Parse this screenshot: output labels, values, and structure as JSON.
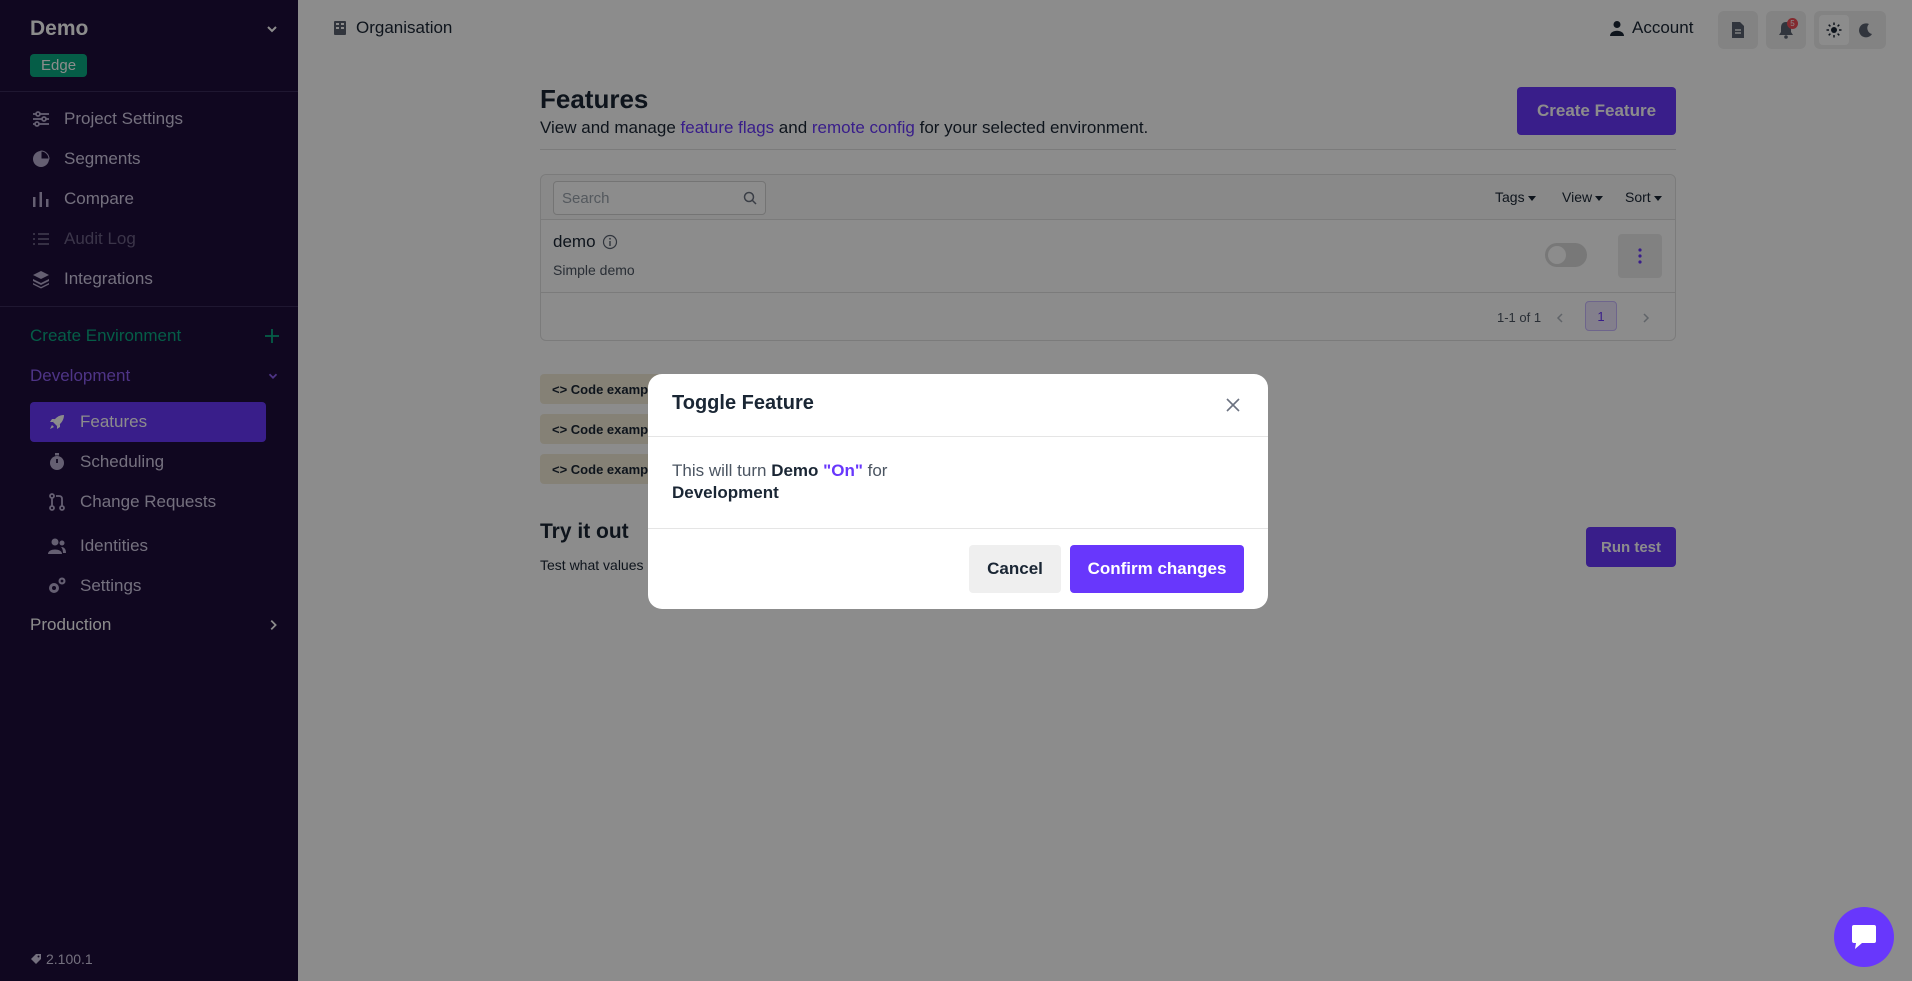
{
  "sidebar": {
    "project_name": "Demo",
    "badge": "Edge",
    "nav": [
      {
        "label": "Project Settings",
        "icon": "sliders-icon"
      },
      {
        "label": "Segments",
        "icon": "pie-chart-icon"
      },
      {
        "label": "Compare",
        "icon": "bar-chart-icon"
      },
      {
        "label": "Audit Log",
        "icon": "list-icon"
      },
      {
        "label": "Integrations",
        "icon": "layers-icon"
      }
    ],
    "create_environment": "Create Environment",
    "environments": [
      {
        "name": "Development",
        "expanded": true
      },
      {
        "name": "Production",
        "expanded": false
      }
    ],
    "env_items": [
      {
        "label": "Features",
        "icon": "rocket-icon",
        "active": true
      },
      {
        "label": "Scheduling",
        "icon": "timer-icon"
      },
      {
        "label": "Change Requests",
        "icon": "git-pull-icon"
      },
      {
        "label": "Identities",
        "icon": "people-icon"
      },
      {
        "label": "Settings",
        "icon": "gears-icon"
      }
    ],
    "version": "2.100.1"
  },
  "topbar": {
    "organisation": "Organisation",
    "account": "Account",
    "notification_count": "5"
  },
  "main": {
    "title": "Features",
    "desc_prefix": "View and manage ",
    "desc_link1": "feature flags",
    "desc_mid": " and ",
    "desc_link2": "remote config",
    "desc_suffix": " for your selected environment.",
    "create_button": "Create Feature",
    "search_placeholder": "Search",
    "filters": {
      "tags": "Tags",
      "view": "View",
      "sort": "Sort"
    },
    "feature": {
      "name": "demo",
      "description": "Simple demo"
    },
    "pagination": {
      "range": "1-1 of 1",
      "page": "1"
    },
    "code_chips": [
      "<> Code exampl",
      "<> Code exampl",
      "<> Code exampl"
    ],
    "try_title": "Try it out",
    "try_desc": "Test what values",
    "run_button": "Run test"
  },
  "modal": {
    "title": "Toggle Feature",
    "body_prefix": "This will turn ",
    "feature": "Demo",
    "state": "\"On\"",
    "body_mid": " for",
    "environment": "Development",
    "cancel": "Cancel",
    "confirm": "Confirm changes"
  },
  "colors": {
    "sidebar_bg": "#1e0d3b",
    "primary": "#6837fc",
    "edge_badge": "#0aaa82"
  }
}
